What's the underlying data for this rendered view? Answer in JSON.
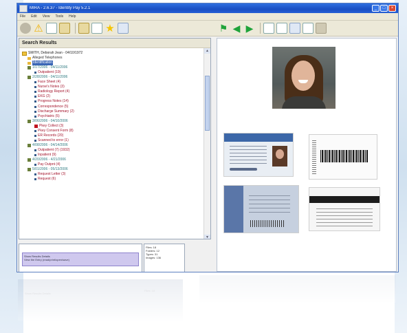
{
  "window": {
    "title": "MIRA - 2.6.37 - Identity Pay 5.2.1",
    "menu": [
      "File",
      "Edit",
      "View",
      "Tools",
      "Help"
    ]
  },
  "search_panel": {
    "header": "Search Results",
    "tree": [
      {
        "kind": "root",
        "text": "SMITH, Deborah Jean - 04/10/1972"
      },
      {
        "kind": "folder",
        "text": "Alleged Telephones"
      },
      {
        "kind": "folder",
        "text": "Identification",
        "selected": true
      },
      {
        "kind": "date",
        "text": "1/17/2006 - 04/11/2006"
      },
      {
        "kind": "item",
        "text": "Outpatient (19)"
      },
      {
        "kind": "date",
        "text": "2/28/2006 - 04/11/2006"
      },
      {
        "kind": "item",
        "text": "Face Sheet (4)"
      },
      {
        "kind": "item",
        "text": "Nurse's Notes (3)"
      },
      {
        "kind": "item",
        "text": "Radiology Report (4)"
      },
      {
        "kind": "item",
        "text": "EKG (2)"
      },
      {
        "kind": "item",
        "text": "Progress Notes (14)"
      },
      {
        "kind": "item",
        "text": "Correspondence (5)"
      },
      {
        "kind": "item",
        "text": "Discharge Summary (2)"
      },
      {
        "kind": "item",
        "text": "Psychiatric (5)"
      },
      {
        "kind": "date",
        "text": "3/06/2006 - 04/10/2006"
      },
      {
        "kind": "red",
        "text": "Pkey Collect (3)"
      },
      {
        "kind": "item",
        "text": "Pkey Consent Form (8)"
      },
      {
        "kind": "item",
        "text": "ER Records (20)"
      },
      {
        "kind": "item",
        "text": "Scanned to error (1)"
      },
      {
        "kind": "date",
        "text": "4/08/2006 - 04/14/2006"
      },
      {
        "kind": "item",
        "text": "Outpatient (7) (1932)"
      },
      {
        "kind": "item",
        "text": "Inpatient (9)"
      },
      {
        "kind": "date",
        "text": "4/20/2006 - 4/21/2006"
      },
      {
        "kind": "item",
        "text": "Pay Outpnt (4)"
      },
      {
        "kind": "date",
        "text": "5/01/2006 - 05/13/2006"
      },
      {
        "kind": "item",
        "text": "Request Letter (3)"
      },
      {
        "kind": "item",
        "text": "Request (6)"
      }
    ]
  },
  "bottom_left": {
    "line1": "Show Results Details",
    "line2": "View the Entry (read/print/open/save)"
  },
  "bottom_right": {
    "lines": [
      "Files: 18",
      "Folders: 12",
      "Types: 31",
      "Images: 136"
    ]
  },
  "icons": {
    "toolbar_left": [
      "circle-icon",
      "warning-icon",
      "document-icon",
      "scan-icon",
      "box-icon",
      "magnifier-icon",
      "star-icon",
      "grid-icon"
    ],
    "toolbar_right": [
      "flag-icon",
      "back-arrow-icon",
      "forward-arrow-icon",
      "gear-icon",
      "text-icon",
      "page-icon",
      "refresh-icon",
      "tan-box-icon"
    ]
  },
  "reflection": {
    "text_left": "Show Results Details",
    "text_right": "Files: 18"
  }
}
